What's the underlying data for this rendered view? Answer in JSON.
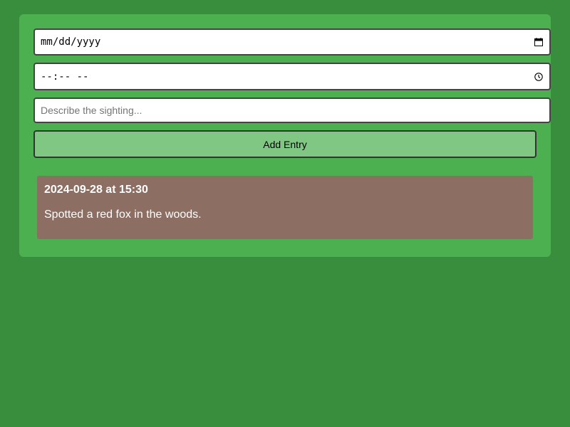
{
  "form": {
    "date_value": "mm/dd/yyyy",
    "time_value": "--:-- --",
    "description_placeholder": "Describe the sighting...",
    "date_icon": "calendar-icon",
    "time_icon": "clock-icon",
    "add_button_label": "Add Entry"
  },
  "entries": [
    {
      "timestamp": "2024-09-28 at 15:30",
      "text": "Spotted a red fox in the woods."
    }
  ],
  "colors": {
    "page_background": "#388e3c",
    "panel_background": "#4caf50",
    "button_background": "#81c784",
    "entry_background": "#8d6e63"
  }
}
